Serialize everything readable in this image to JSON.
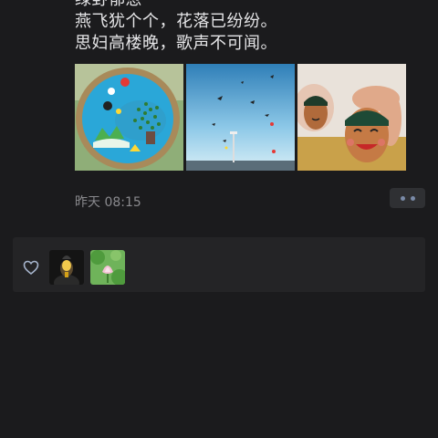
{
  "post": {
    "poem_lines": [
      "绿野郁葱",
      "燕飞犹个个，花落已纷纷。",
      "思妇高楼晚，歌声不可闻。"
    ],
    "photos": [
      {
        "icon": "painted-plate-image"
      },
      {
        "icon": "kites-sky-image"
      },
      {
        "icon": "painted-eggs-image"
      }
    ],
    "timestamp": "昨天 08:15"
  },
  "likes": {
    "icon": "heart-outline-icon",
    "avatars": [
      "avatar-dark",
      "avatar-lotus"
    ]
  },
  "colors": {
    "background": "#1b1b1d",
    "panel": "#242426",
    "text": "#e6e6e8",
    "muted": "#8a8a8e",
    "more_button": "#2f3033",
    "more_dots": "#7a8ba8"
  }
}
